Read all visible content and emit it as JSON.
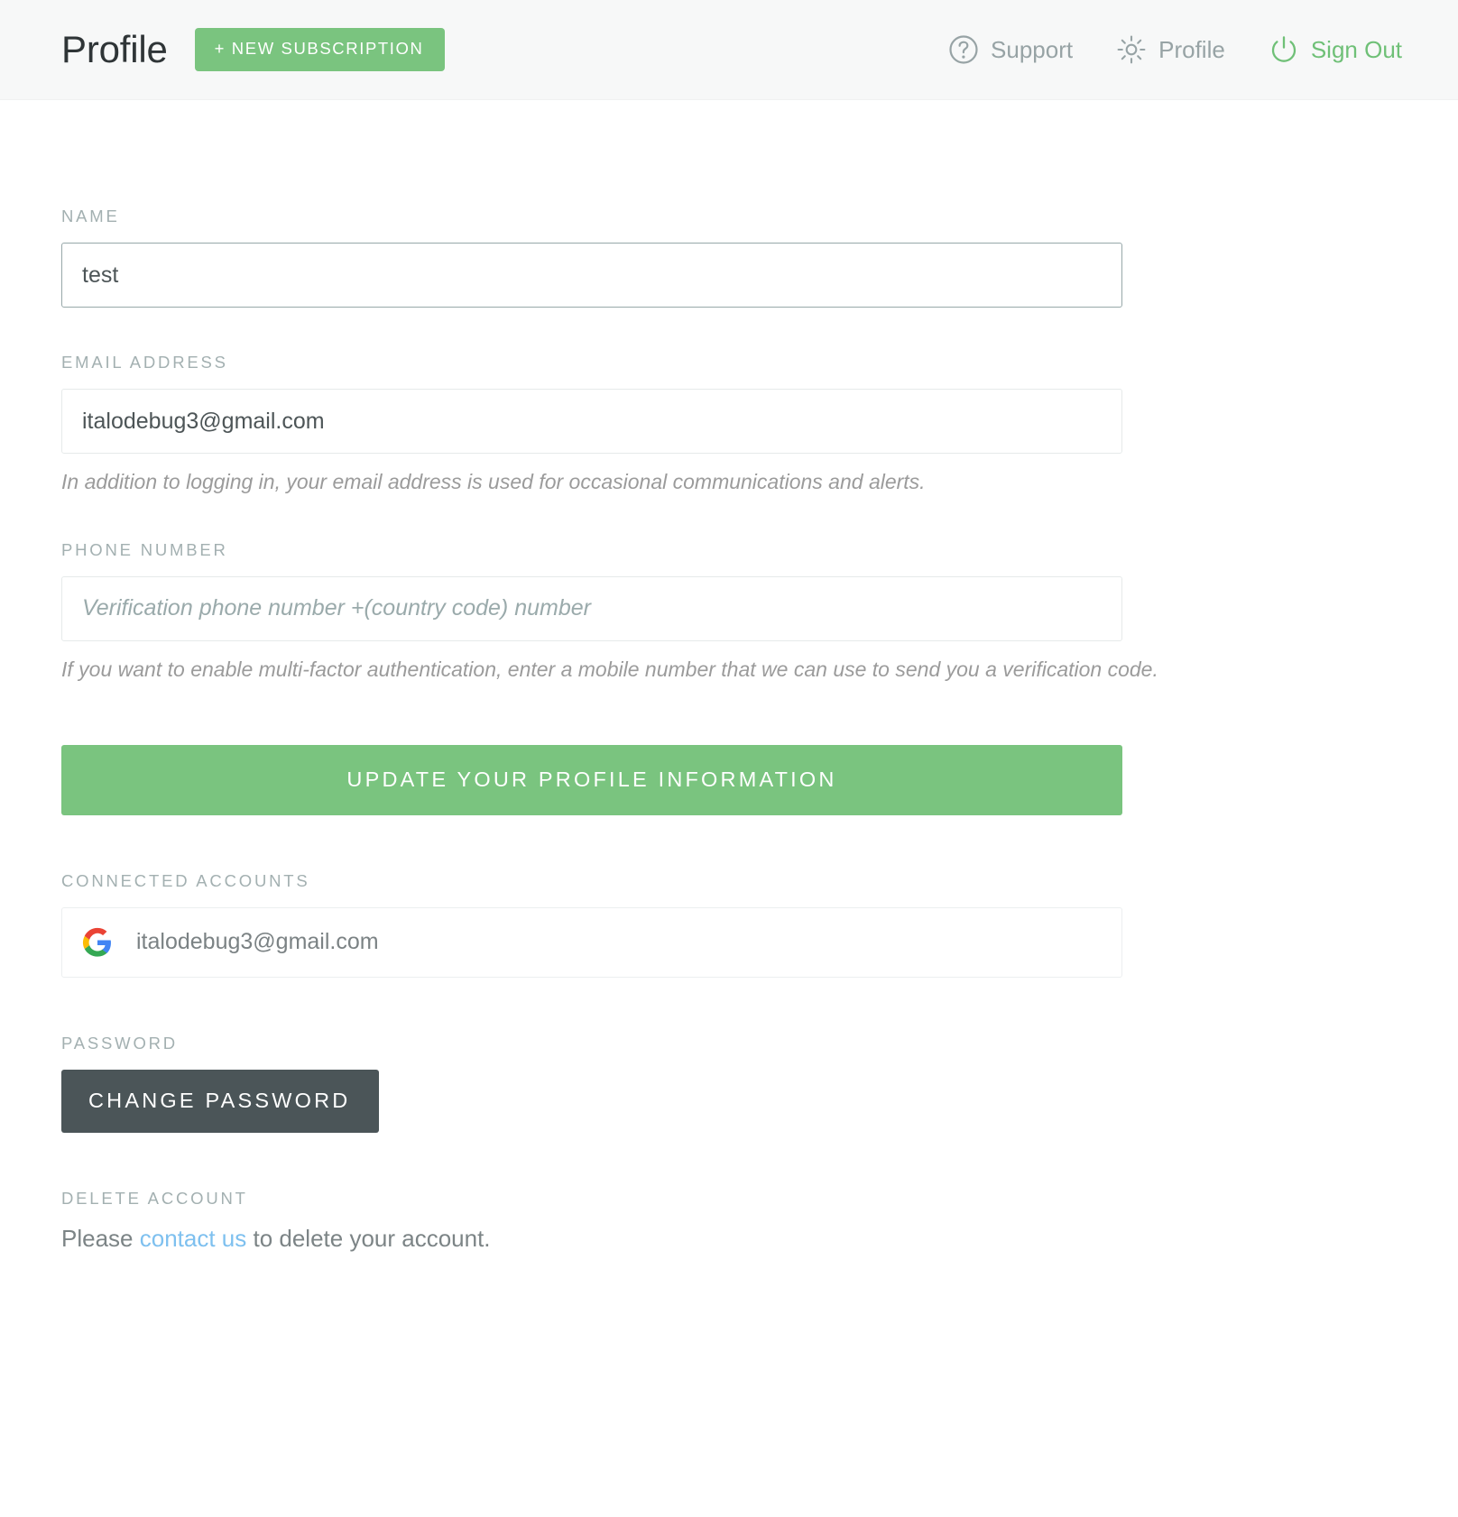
{
  "header": {
    "title": "Profile",
    "new_subscription_label": "+ NEW SUBSCRIPTION",
    "nav": [
      {
        "label": "Support",
        "icon": "question-circle-icon"
      },
      {
        "label": "Profile",
        "icon": "gear-icon"
      },
      {
        "label": "Sign Out",
        "icon": "power-icon"
      }
    ]
  },
  "form": {
    "name": {
      "label": "NAME",
      "value": "test",
      "placeholder": ""
    },
    "email": {
      "label": "EMAIL ADDRESS",
      "value": "italodebug3@gmail.com",
      "placeholder": "",
      "helper": "In addition to logging in, your email address is used for occasional communications and alerts."
    },
    "phone": {
      "label": "PHONE NUMBER",
      "value": "",
      "placeholder": "Verification phone number +(country code) number",
      "helper": "If you want to enable multi-factor authentication, enter a mobile number that we can use to send you a verification code."
    },
    "update_button_label": "UPDATE YOUR PROFILE INFORMATION"
  },
  "connected_accounts": {
    "label": "CONNECTED ACCOUNTS",
    "items": [
      {
        "provider_icon": "google-g-icon",
        "email": "italodebug3@gmail.com"
      }
    ]
  },
  "password": {
    "label": "PASSWORD",
    "change_button_label": "CHANGE PASSWORD"
  },
  "delete_account": {
    "label": "DELETE ACCOUNT",
    "text_before": "Please ",
    "link_text": "contact us",
    "text_after": " to delete your account."
  },
  "colors": {
    "accent_green": "#7ac47f",
    "signout_green": "#6fc077",
    "dark_button": "#4b5558",
    "label_gray": "#a3b0b1",
    "link_blue": "#7ec0ef",
    "header_bg": "#f7f8f8"
  }
}
